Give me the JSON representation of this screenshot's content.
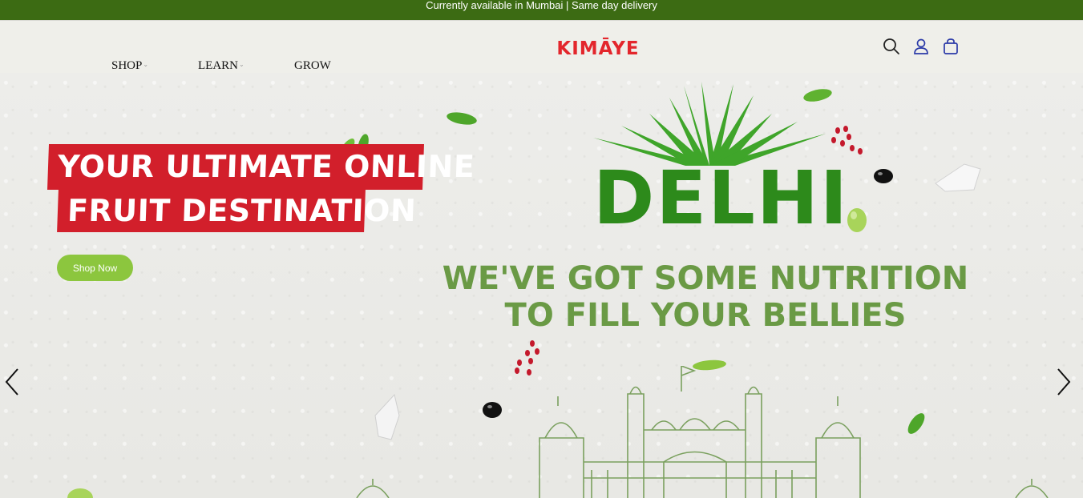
{
  "announcement": "Currently available in Mumbai | Same day delivery",
  "nav": {
    "items": [
      {
        "label": "SHOP",
        "has_dropdown": true
      },
      {
        "label": "LEARN",
        "has_dropdown": true
      },
      {
        "label": "GROW",
        "has_dropdown": false
      }
    ],
    "dropdown_icon": "chevron-down-icon"
  },
  "logo": {
    "text": "KIMĀYE",
    "color": "#e3262c"
  },
  "header_icons": [
    "search-icon",
    "user-icon",
    "cart-icon"
  ],
  "hero": {
    "promo_line_1": "YOUR ULTIMATE ONLINE",
    "promo_line_2": "FRUIT DESTINATION",
    "cta_label": "Shop Now",
    "city": "DELHI",
    "tagline_1": "WE'VE GOT SOME NUTRITION",
    "tagline_2": "TO FILL YOUR BELLIES",
    "prev_icon": "chevron-left-icon",
    "next_icon": "chevron-right-icon"
  },
  "colors": {
    "announcement_bg": "#3c6b13",
    "promo_red": "#d21f2b",
    "cta_green": "#8cc63e",
    "delhi_green": "#2d8a1b",
    "tagline_green": "#6a9a45",
    "icon_blue": "#2b3aa8"
  }
}
